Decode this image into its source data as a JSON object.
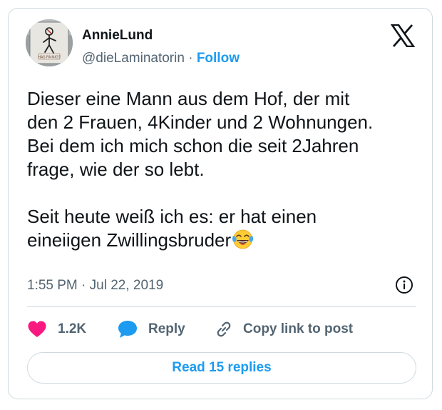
{
  "author": {
    "display_name": "AnnieLund",
    "handle": "@dieLaminatorin",
    "separator": " · ",
    "follow_label": "Follow",
    "avatar_sign_text": "HAS PA MIG?"
  },
  "tweet": {
    "text": "Dieser eine Mann aus dem Hof, der mit\nden 2 Frauen, 4Kinder und 2 Wohnungen.\nBei dem ich mich schon die seit 2Jahren\nfrage, wie der so lebt.\n\nSeit heute weiß ich es: er hat einen\neineiigen Zwillingsbruder",
    "emoji": "face-with-tears-of-joy",
    "timestamp": "1:55 PM · Jul 22, 2019"
  },
  "actions": {
    "like_count": "1.2K",
    "reply_label": "Reply",
    "copy_label": "Copy link to post",
    "read_replies_label": "Read 15 replies"
  },
  "icons": {
    "logo": "x-logo-icon",
    "info": "info-icon",
    "like": "heart-icon",
    "reply": "speech-bubble-icon",
    "copy": "link-icon"
  },
  "colors": {
    "accent": "#1d9bf0",
    "like": "#f91880",
    "text_primary": "#0f1419",
    "text_secondary": "#536471",
    "border": "#cfd9de"
  }
}
